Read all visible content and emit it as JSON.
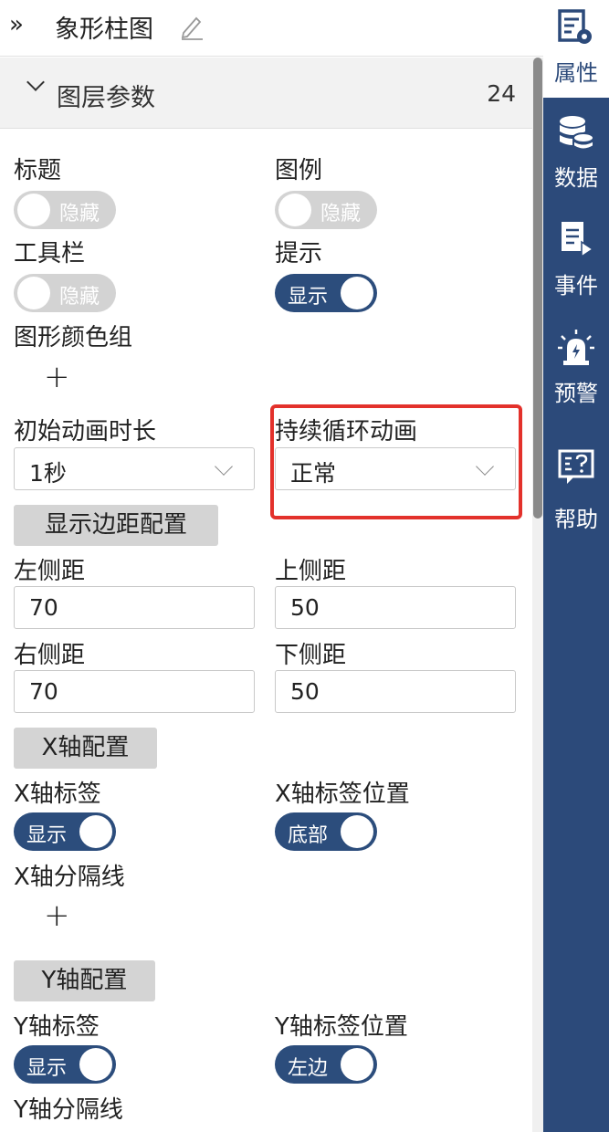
{
  "header": {
    "collapse_glyph": "»",
    "title": "象形柱图"
  },
  "layer": {
    "label": "图层参数",
    "count": "24"
  },
  "fields": {
    "title_label": "标题",
    "title_toggle": "隐藏",
    "legend_label": "图例",
    "legend_toggle": "隐藏",
    "toolbar_label": "工具栏",
    "toolbar_toggle": "隐藏",
    "tooltip_label": "提示",
    "tooltip_toggle": "显示",
    "color_group_label": "图形颜色组",
    "add_glyph": "+",
    "init_anim_label": "初始动画时长",
    "init_anim_value": "1秒",
    "loop_anim_label": "持续循环动画",
    "loop_anim_value": "正常",
    "margin_button": "显示边距配置",
    "left_margin_label": "左侧距",
    "left_margin_value": "70",
    "top_margin_label": "上侧距",
    "top_margin_value": "50",
    "right_margin_label": "右侧距",
    "right_margin_value": "70",
    "bottom_margin_label": "下侧距",
    "bottom_margin_value": "50",
    "xaxis_button": "X轴配置",
    "xaxis_label_label": "X轴标签",
    "xaxis_label_toggle": "显示",
    "xaxis_pos_label": "X轴标签位置",
    "xaxis_pos_toggle": "底部",
    "xaxis_split_label": "X轴分隔线",
    "yaxis_button": "Y轴配置",
    "yaxis_label_label": "Y轴标签",
    "yaxis_label_toggle": "显示",
    "yaxis_pos_label": "Y轴标签位置",
    "yaxis_pos_toggle": "左边",
    "yaxis_split_label": "Y轴分隔线"
  },
  "sidebar": {
    "items": [
      {
        "label": "属性",
        "icon": "properties-icon",
        "active": true
      },
      {
        "label": "数据",
        "icon": "database-icon",
        "active": false
      },
      {
        "label": "事件",
        "icon": "event-icon",
        "active": false
      },
      {
        "label": "预警",
        "icon": "alarm-icon",
        "active": false
      },
      {
        "label": "帮助",
        "icon": "help-icon",
        "active": false
      }
    ]
  },
  "colors": {
    "sidebar": "#2c4a7a",
    "toggle_on": "#2c4d7c",
    "toggle_off": "#d3d3d3",
    "highlight": "#e3312b"
  }
}
